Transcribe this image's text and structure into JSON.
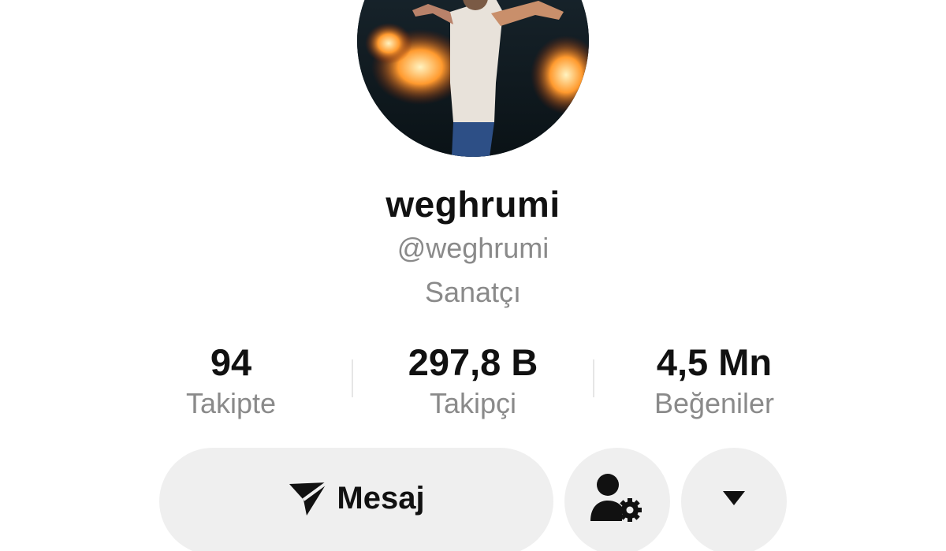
{
  "profile": {
    "display_name": "weghrumi",
    "username": "@weghrumi",
    "category": "Sanatçı"
  },
  "stats": {
    "following": {
      "value": "94",
      "label": "Takipte"
    },
    "followers": {
      "value": "297,8 B",
      "label": "Takipçi"
    },
    "likes": {
      "value": "4,5 Mn",
      "label": "Beğeniler"
    }
  },
  "actions": {
    "message_label": "Mesaj",
    "message_icon": "send-icon",
    "friend_settings_icon": "user-gear-icon",
    "more_icon": "chevron-down-icon"
  },
  "colors": {
    "text_primary": "#111111",
    "text_secondary": "#8a8a8a",
    "button_bg": "#efefef"
  }
}
